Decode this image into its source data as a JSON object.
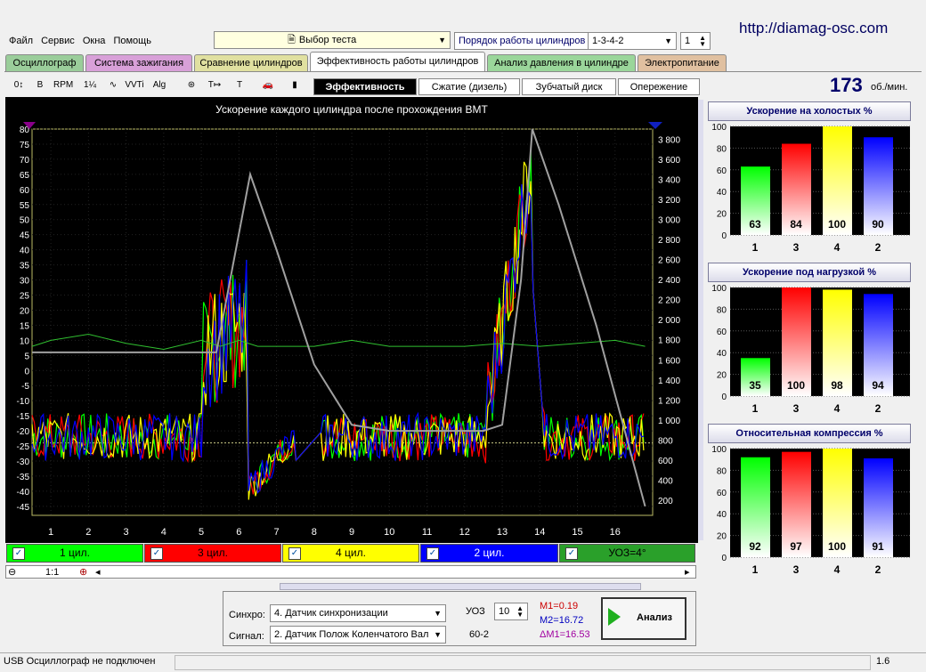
{
  "site_url": "http://diamag-osc.com",
  "menu": [
    "Файл",
    "Сервис",
    "Окна",
    "Помощь"
  ],
  "test_select": {
    "value": "Выбор теста"
  },
  "firing_order": {
    "label": "Порядок работы цилиндров",
    "value": "1-3-4-2",
    "spin": "1"
  },
  "tabs": [
    "Осциллограф",
    "Система зажигания",
    "Сравнение цилиндров",
    "Эффективность работы цилиндров",
    "Анализ давления в цилиндре",
    "Электропитание"
  ],
  "tab_colors": [
    "#9acd9a",
    "#d8a0d8",
    "#e0e0a0",
    "#ffffff",
    "#9ad69a",
    "#e0c0a0"
  ],
  "toolbar_icons": [
    "osc-icon",
    "bold-icon",
    "rpm-icon",
    "numbers-icon",
    "graph-icon",
    "vvti-icon",
    "alg-icon",
    "bug-icon",
    "t1234-icon",
    "marker-icon",
    "car-icon",
    "chart-icon"
  ],
  "toolbar_labels": [
    "0↕",
    "B",
    "RPM",
    "1¼",
    "∿",
    "VVTi",
    "Alg 1/2",
    "⊛",
    "T↦",
    "Т",
    "🚗",
    "▮"
  ],
  "subtabs": [
    "Эффективность",
    "Сжатие (дизель)",
    "Зубчатый диск",
    "Опережение"
  ],
  "rpm": {
    "value": "173",
    "unit": "об./мин."
  },
  "chart_data": {
    "type": "line",
    "title": "Ускорение каждого цилиндра после прохождения ВМТ",
    "x_ticks": [
      "1",
      "2",
      "3",
      "4",
      "5",
      "6",
      "7",
      "8",
      "9",
      "10",
      "11",
      "12",
      "13",
      "14",
      "15",
      "16"
    ],
    "y_left_ticks": [
      "80",
      "75",
      "70",
      "65",
      "60",
      "55",
      "50",
      "45",
      "40",
      "35",
      "30",
      "25",
      "20",
      "15",
      "10",
      "5",
      "0",
      "-5",
      "-10",
      "-15",
      "-20",
      "-25",
      "-30",
      "-35",
      "-40",
      "-45"
    ],
    "y_right_ticks": [
      "3 800",
      "3 600",
      "3 400",
      "3 200",
      "3 000",
      "2 800",
      "2 600",
      "2 400",
      "2 200",
      "2 000",
      "1 800",
      "1 600",
      "1 400",
      "1 200",
      "1 000",
      "800",
      "600",
      "400",
      "200"
    ],
    "ylim_left": [
      -48,
      80
    ],
    "series": [
      {
        "name": "1 цил.",
        "color": "#00ff00"
      },
      {
        "name": "3 цил.",
        "color": "#ff0000"
      },
      {
        "name": "4 цил.",
        "color": "#ffff00"
      },
      {
        "name": "2 цил.",
        "color": "#0000ff"
      },
      {
        "name": "УОЗ=4°",
        "color": "#30c030"
      }
    ],
    "speed_curve_x": [
      0.5,
      5.4,
      6.3,
      7.0,
      8.0,
      9.0,
      10.0,
      11.0,
      12.0,
      12.5,
      13.0,
      13.5,
      13.8,
      14.5,
      15.5,
      16.8
    ],
    "speed_curve_y": [
      6,
      6,
      65,
      40,
      2,
      -18,
      -20,
      -20,
      -20,
      -20,
      -18,
      30,
      80,
      55,
      15,
      -45
    ],
    "idle_curve_x": [
      0.5,
      1,
      2,
      3,
      4,
      5,
      5.5,
      6,
      6.5,
      7,
      8,
      9,
      10,
      11,
      12,
      13,
      14,
      15,
      16,
      16.8
    ],
    "idle_curve_y": [
      8,
      10,
      12,
      9,
      7,
      10,
      8,
      10,
      8,
      8,
      8,
      10,
      8,
      8,
      8,
      9,
      8,
      9,
      10,
      8
    ]
  },
  "legend_buttons": [
    "1 цил.",
    "3 цил.",
    "4 цил.",
    "2 цил.",
    "УОЗ=4°"
  ],
  "legend_colors": [
    "#00ff00",
    "#ff0000",
    "#ffff00",
    "#0000ff",
    "#2aa02a"
  ],
  "zoom_label": "1:1",
  "bars": [
    {
      "title": "Ускорение на холостых %",
      "labels": [
        "1",
        "3",
        "4",
        "2"
      ],
      "values": [
        63,
        84,
        100,
        90
      ]
    },
    {
      "title": "Ускорение под нагрузкой %",
      "labels": [
        "1",
        "3",
        "4",
        "2"
      ],
      "values": [
        35,
        100,
        98,
        94
      ]
    },
    {
      "title": "Относительная компрессия %",
      "labels": [
        "1",
        "3",
        "4",
        "2"
      ],
      "values": [
        92,
        97,
        100,
        91
      ]
    }
  ],
  "bar_axis": [
    "100",
    "80",
    "60",
    "40",
    "20",
    "0"
  ],
  "bar_colors": [
    "#00ff00",
    "#ff0000",
    "#ffff00",
    "#0000ff"
  ],
  "sync": {
    "label": "Синхро:",
    "value": "4. Датчик синхронизации"
  },
  "signal": {
    "label": "Сигнал:",
    "value": "2. Датчик Полож Коленчатого Вал"
  },
  "uoz": {
    "label": "УОЗ",
    "value": "10",
    "sub": "60-2"
  },
  "measure": {
    "m1": "M1=0.19",
    "m2": "M2=16.72",
    "dm": "ΔM1=16.53"
  },
  "analyze_button": "Анализ",
  "status": {
    "left": "USB Осциллограф не подключен",
    "right": "1.6"
  }
}
